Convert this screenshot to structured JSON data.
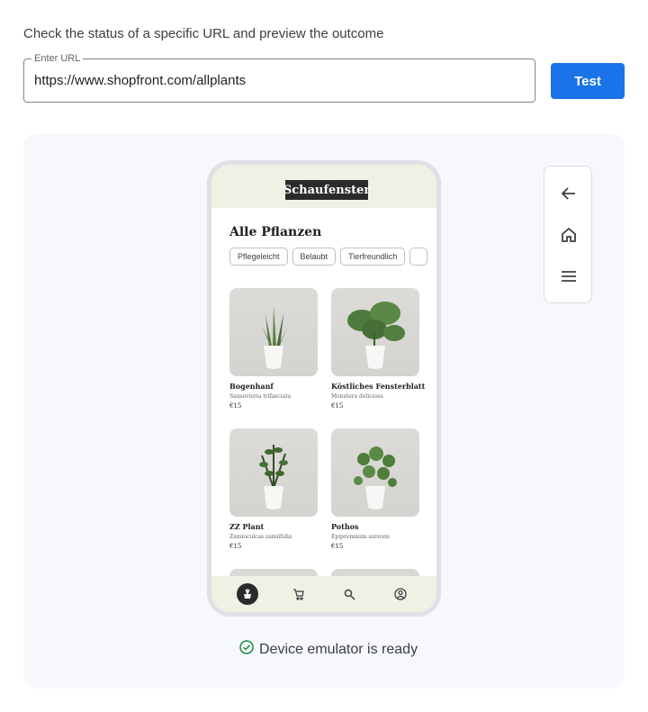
{
  "instruction": "Check the status of a specific URL and preview the outcome",
  "url_input": {
    "legend": "Enter URL",
    "value": "https://www.shopfront.com/allplants"
  },
  "test_button": "Test",
  "phone": {
    "brand": "Schaufenster",
    "heading": "Alle Pflanzen",
    "chips": [
      "Pflegeleicht",
      "Belaubt",
      "Tierfreundlich"
    ],
    "products": [
      {
        "name": "Bogenhanf",
        "scientific": "Sansevieria trifasciata",
        "price": "€15",
        "icon": "snake-plant"
      },
      {
        "name": "Köstliches Fensterblatt",
        "scientific": "Monstera deliciosa",
        "price": "€15",
        "icon": "monstera-plant"
      },
      {
        "name": "ZZ Plant",
        "scientific": "Zamioculcas zamiifolia",
        "price": "€15",
        "icon": "zz-plant"
      },
      {
        "name": "Pothos",
        "scientific": "Epipremnum aureum",
        "price": "€15",
        "icon": "pothos-plant"
      }
    ],
    "bottom_nav": [
      "store-logo-icon",
      "cart-icon",
      "search-icon",
      "account-icon"
    ]
  },
  "controls": [
    "back-arrow-icon",
    "home-icon",
    "menu-icon"
  ],
  "status": {
    "text": "Device emulator is ready",
    "icon": "check-circle-icon",
    "color": "#1e8e3e"
  },
  "colors": {
    "accent": "#1a73e8",
    "panel": "#f6f8fc",
    "phone_header": "#eef1e3"
  }
}
